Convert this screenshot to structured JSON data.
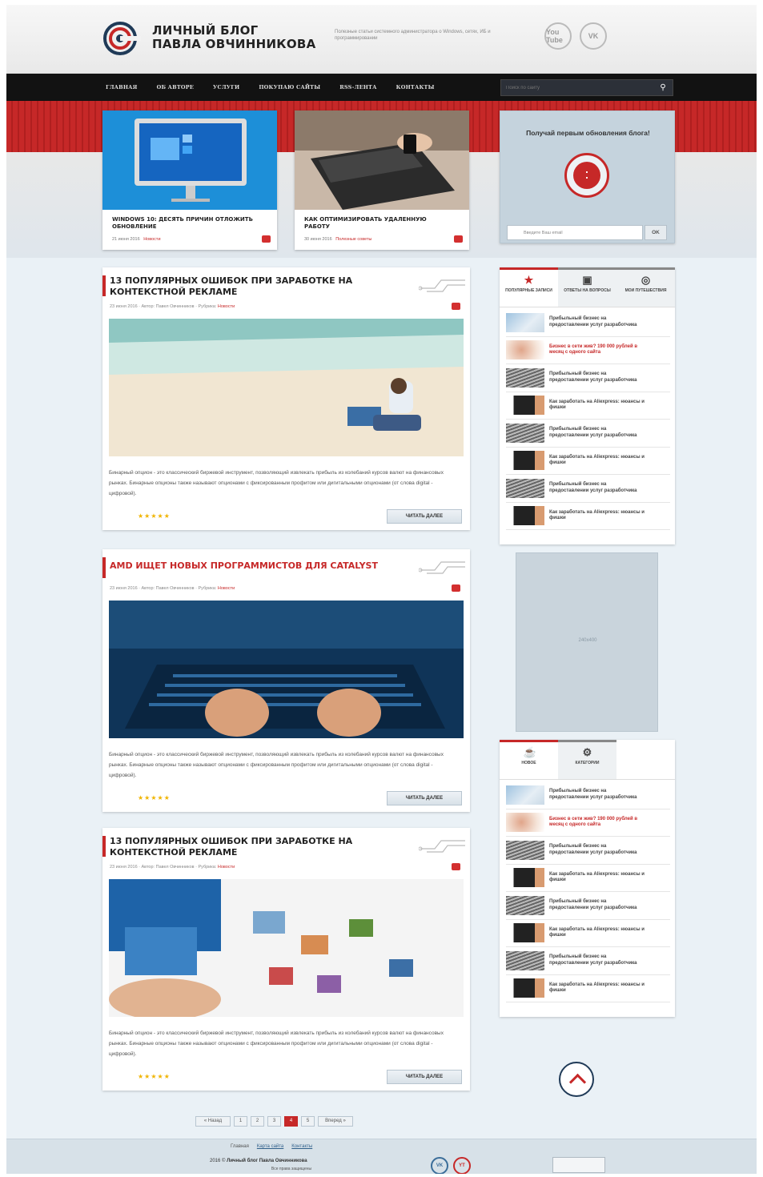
{
  "header": {
    "brand_line1": "ЛИЧНЫЙ БЛОГ",
    "brand_line2": "ПАВЛА ОВЧИННИКОВА",
    "tagline": "Полезные статьи системного администратора о Windows, сетях, ИБ и программировании",
    "social": [
      "You Tube",
      "VK"
    ]
  },
  "nav": {
    "items": [
      "ГЛАВНАЯ",
      "ОБ АВТОРЕ",
      "УСЛУГИ",
      "ПОКУПАЮ САЙТЫ",
      "RSS-ЛЕНТА",
      "КОНТАКТЫ"
    ],
    "search_placeholder": "Поиск по сайту"
  },
  "featured": [
    {
      "title": "WINDOWS 10: ДЕСЯТЬ ПРИЧИН ОТЛОЖИТЬ ОБНОВЛЕНИЕ",
      "date": "21 июня 2016",
      "category": "Новости"
    },
    {
      "title": "КАК ОПТИМИЗИРОВАТЬ УДАЛЕННУЮ РАБОТУ",
      "date": "30 июня 2016",
      "category": "Полезные советы"
    }
  ],
  "subscribe": {
    "title": "Получай первым обновления блога!",
    "email_placeholder": "Введите Ваш email",
    "ok_label": "OK"
  },
  "posts": [
    {
      "title": "13 ПОПУЛЯРНЫХ ОШИБОК ПРИ ЗАРАБОТКЕ НА КОНТЕКСТНОЙ РЕКЛАМЕ",
      "meta": "23 июня 2016 · Автор: Павел Овчинников · Рубрика:",
      "rubric": "Новости",
      "text": "Бинарный опцион - это классический биржевой инструмент, позволяющий извлекать прибыль из колебаний курсов валют на финансовых рынках. Бинарные опционы также называют опционами с фиксированным профитом или дигитальными опционами (от слова digital - цифровой).",
      "read_more": "ЧИТАТЬ ДАЛЕЕ"
    },
    {
      "title": "AMD ИЩЕТ НОВЫХ ПРОГРАММИСТОВ ДЛЯ CATALYST",
      "meta": "23 июня 2016 · Автор: Павел Овчинников · Рубрика:",
      "rubric": "Новости",
      "text": "Бинарный опцион - это классический биржевой инструмент, позволяющий извлекать прибыль из колебаний курсов валют на финансовых рынках. Бинарные опционы также называют опционами с фиксированным профитом или дигитальными опционами (от слова digital - цифровой).",
      "read_more": "ЧИТАТЬ ДАЛЕЕ"
    },
    {
      "title": "13 ПОПУЛЯРНЫХ ОШИБОК ПРИ ЗАРАБОТКЕ НА КОНТЕКСТНОЙ РЕКЛАМЕ",
      "meta": "23 июня 2016 · Автор: Павел Овчинников · Рубрика:",
      "rubric": "Новости",
      "text": "Бинарный опцион - это классический биржевой инструмент, позволяющий извлекать прибыль из колебаний курсов валют на финансовых рынках. Бинарные опционы также называют опционами с фиксированным профитом или дигитальными опционами (от слова digital - цифровой).",
      "read_more": "ЧИТАТЬ ДАЛЕЕ"
    }
  ],
  "widget1": {
    "tabs": [
      "ПОПУЛЯРНЫЕ ЗАПИСИ",
      "ОТВЕТЫ НА ВОПРОСЫ",
      "МОИ ПУТЕШЕСТВИЯ"
    ],
    "items": [
      "Прибыльный бизнес на предоставлении услуг разработчика",
      "Бизнес в сети жив? 190 000 рублей в месяц с одного сайта",
      "Прибыльный бизнес на предоставлении услуг разработчика",
      "Как заработать на Aliexpress: нюансы и фишки",
      "Прибыльный бизнес на предоставлении услуг разработчика",
      "Как заработать на Aliexpress: нюансы и фишки",
      "Прибыльный бизнес на предоставлении услуг разработчика",
      "Как заработать на Aliexpress: нюансы и фишки"
    ]
  },
  "ad": {
    "label": "240x400"
  },
  "widget2": {
    "tabs": [
      "НОВОЕ",
      "КАТЕГОРИИ"
    ],
    "items": [
      "Прибыльный бизнес на предоставлении услуг разработчика",
      "Бизнес в сети жив? 190 000 рублей в месяц с одного сайта",
      "Прибыльный бизнес на предоставлении услуг разработчика",
      "Как заработать на Aliexpress: нюансы и фишки",
      "Прибыльный бизнес на предоставлении услуг разработчика",
      "Как заработать на Aliexpress: нюансы и фишки",
      "Прибыльный бизнес на предоставлении услуг разработчика",
      "Как заработать на Aliexpress: нюансы и фишки"
    ]
  },
  "pager": {
    "prev": "« Назад",
    "pages": [
      "1",
      "2",
      "3",
      "4",
      "5"
    ],
    "current": "4",
    "next": "Вперед »"
  },
  "footer": {
    "links": [
      "Главная",
      "Карта сайта",
      "Контакты"
    ],
    "copy_year": "2016 ©",
    "copy_name": "Личный блог Павла Овчинникова",
    "rights": "Все права защищены",
    "social": [
      "VK",
      "YT"
    ]
  },
  "colors": {
    "accent": "#c62828",
    "nav_bg": "#121212",
    "page_bg": "#eaf1f6"
  }
}
